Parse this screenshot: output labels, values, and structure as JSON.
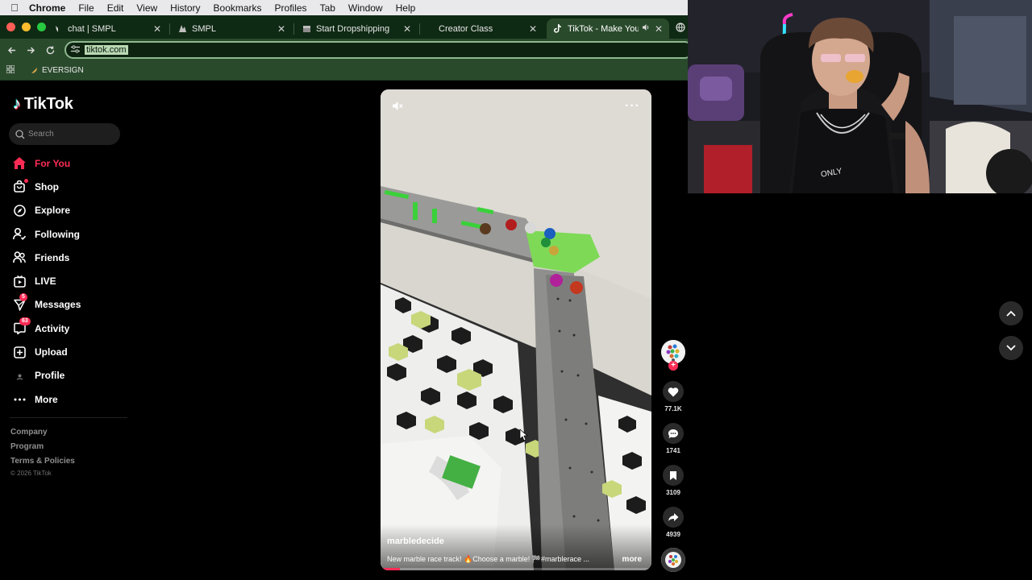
{
  "menubar": {
    "app": "Chrome",
    "items": [
      "File",
      "Edit",
      "View",
      "History",
      "Bookmarks",
      "Profiles",
      "Tab",
      "Window",
      "Help"
    ]
  },
  "tabs": [
    {
      "label": "chat | SMPL",
      "icon": "chat-favicon"
    },
    {
      "label": "SMPL",
      "icon": "smpl-favicon"
    },
    {
      "label": "Start Dropshipping",
      "icon": "box-favicon"
    },
    {
      "label": "Creator Class",
      "icon": "none"
    },
    {
      "label": "TikTok - Make Your Day",
      "icon": "tiktok-favicon",
      "active": true
    }
  ],
  "toolbar": {
    "url": "tiktok.com"
  },
  "bookmarks": [
    {
      "label": "EVERSIGN"
    }
  ],
  "tiktok": {
    "logo_text": "TikTok",
    "search_placeholder": "Search",
    "nav": [
      {
        "label": "For You",
        "icon": "home-icon",
        "active": true
      },
      {
        "label": "Shop",
        "icon": "shop-bag-icon",
        "dot": true
      },
      {
        "label": "Explore",
        "icon": "compass-icon"
      },
      {
        "label": "Following",
        "icon": "following-icon"
      },
      {
        "label": "Friends",
        "icon": "friends-icon"
      },
      {
        "label": "LIVE",
        "icon": "live-icon"
      },
      {
        "label": "Messages",
        "icon": "messages-icon",
        "badge": "5"
      },
      {
        "label": "Activity",
        "icon": "activity-icon",
        "badge": "63"
      },
      {
        "label": "Upload",
        "icon": "upload-icon"
      },
      {
        "label": "Profile",
        "icon": "profile-icon"
      },
      {
        "label": "More",
        "icon": "more-dots-icon"
      }
    ],
    "footer": {
      "links": [
        "Company",
        "Program",
        "Terms & Policies"
      ],
      "copyright": "© 2026 TikTok"
    }
  },
  "video": {
    "author": "marbledecide",
    "caption": "New marble race track! 🔥Choose a marble! 🏁#marblerace ...",
    "more_label": "more",
    "progress": 0.07,
    "likes": "77.1K",
    "comments": "1741",
    "saves": "3109",
    "shares": "4939"
  },
  "colors": {
    "accent": "#fe2c55",
    "chrome_frame": "#0f2a14",
    "chrome_toolbar": "#2a4a2c"
  }
}
